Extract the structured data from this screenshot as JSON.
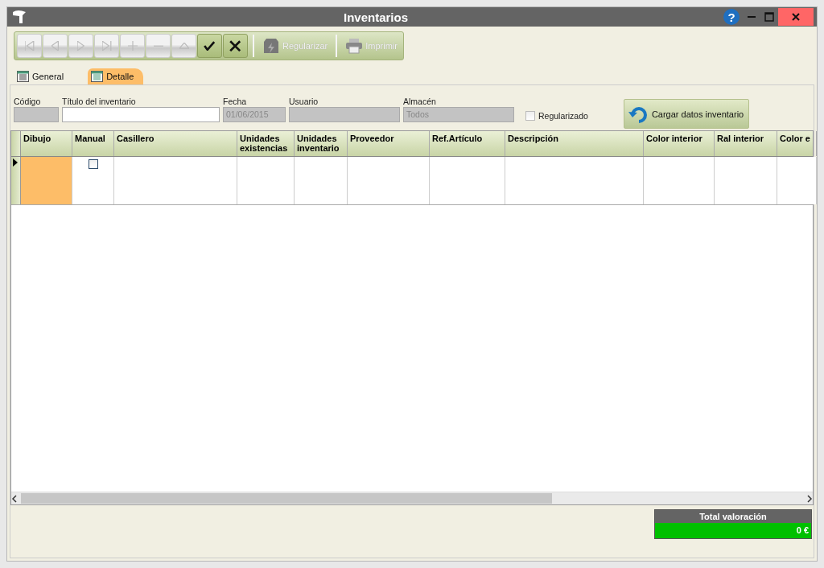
{
  "window": {
    "title": "Inventarios",
    "help_button": "?"
  },
  "toolbar": {
    "buttons": [
      {
        "kind": "first",
        "disabled": true
      },
      {
        "kind": "prev",
        "disabled": true
      },
      {
        "kind": "next",
        "disabled": true
      },
      {
        "kind": "last",
        "disabled": true
      },
      {
        "kind": "add",
        "disabled": true
      },
      {
        "kind": "remove",
        "disabled": true
      },
      {
        "kind": "up",
        "disabled": true
      },
      {
        "kind": "confirm",
        "disabled": false
      },
      {
        "kind": "cancel",
        "disabled": false
      }
    ],
    "actions": [
      {
        "kind": "regularize",
        "label": "Regularizar",
        "disabled": true
      },
      {
        "kind": "print",
        "label": "Imprimir",
        "disabled": true
      }
    ]
  },
  "tabs": [
    {
      "label": "General",
      "selected": false
    },
    {
      "label": "Detalle",
      "selected": true
    }
  ],
  "form": {
    "fields": [
      {
        "label": "Código",
        "disabled": true
      },
      {
        "label": "Título del inventario",
        "disabled": false
      },
      {
        "label": "Fecha",
        "value": "01/06/2015",
        "disabled": true
      },
      {
        "label": "Usuario",
        "disabled": true
      },
      {
        "label": "Almacén",
        "value": "Todos",
        "disabled": true
      }
    ],
    "regularizado": {
      "label": "Regularizado",
      "checked": false
    },
    "load_button": "Cargar datos inventario"
  },
  "table": {
    "columns": [
      "Dibujo",
      "Manual",
      "Casillero",
      "Unidades existencias",
      "Unidades inventario",
      "Proveedor",
      "Ref.Artículo",
      "Descripción",
      "Color interior",
      "Ral interior",
      "Color e"
    ],
    "rows": [
      {
        "current": true,
        "manual": false
      }
    ]
  },
  "total": {
    "label": "Total valoración",
    "value": "0 €"
  }
}
